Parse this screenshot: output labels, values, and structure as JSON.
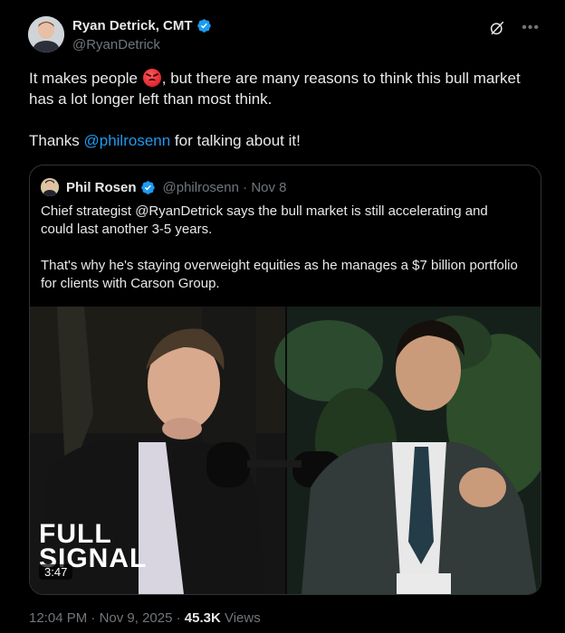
{
  "author": {
    "display_name": "Ryan Detrick, CMT",
    "handle": "@RyanDetrick"
  },
  "post": {
    "text_before_emoji": "It makes people ",
    "emoji": "angry-face-emoji",
    "text_after_emoji": ", but there are many reasons to think this bull market has a lot longer left than most think.",
    "thanks_prefix": "Thanks ",
    "mention": "@philrosenn",
    "thanks_suffix": " for talking about it!"
  },
  "quoted": {
    "display_name": "Phil Rosen",
    "handle": "@philrosenn",
    "separator": "·",
    "date": "Nov 8",
    "paragraph1": "Chief strategist @RyanDetrick says the bull market is still accelerating and could last another 3-5 years.",
    "paragraph2": "That's why he's staying overweight equities as he manages a $7 billion portfolio for clients with Carson Group.",
    "video": {
      "duration": "3:47",
      "brand_line1": "FULL",
      "brand_line2": "SIGNAL"
    }
  },
  "footer": {
    "time": "12:04 PM",
    "separator": " · ",
    "date": "Nov 9, 2025",
    "views_count": "45.3K",
    "views_label": " Views"
  },
  "colors": {
    "background": "#000000",
    "text": "#e7e9ea",
    "muted": "#71767b",
    "link": "#1d9bf0",
    "verified": "#1d9bf0",
    "border": "#2f3336"
  },
  "icons": [
    "verified-badge-icon",
    "grok-icon",
    "more-options-icon"
  ]
}
